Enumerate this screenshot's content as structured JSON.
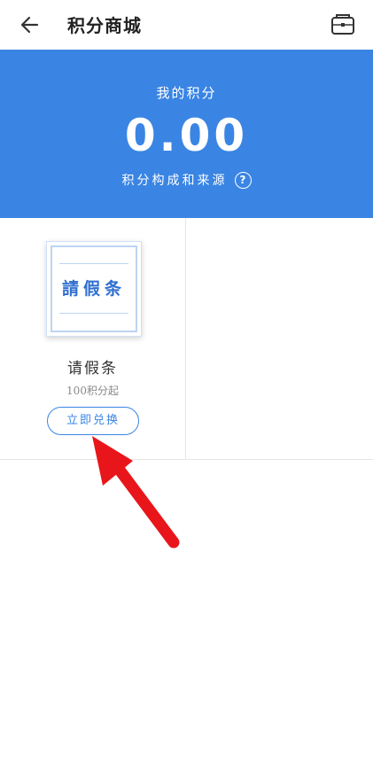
{
  "app": {
    "title": "积分商城"
  },
  "points": {
    "label": "我的积分",
    "value": "0.00",
    "source_link": "积分构成和来源",
    "help_icon": "?"
  },
  "products": [
    {
      "thumbnail_text": "請假条",
      "name": "请假条",
      "points": "100积分起",
      "button": "立即兑换"
    }
  ],
  "colors": {
    "brand_blue": "#3a85e4",
    "annotation_red": "#e8161b"
  },
  "icons": [
    "back-arrow-icon",
    "wallet-icon",
    "help-icon"
  ]
}
